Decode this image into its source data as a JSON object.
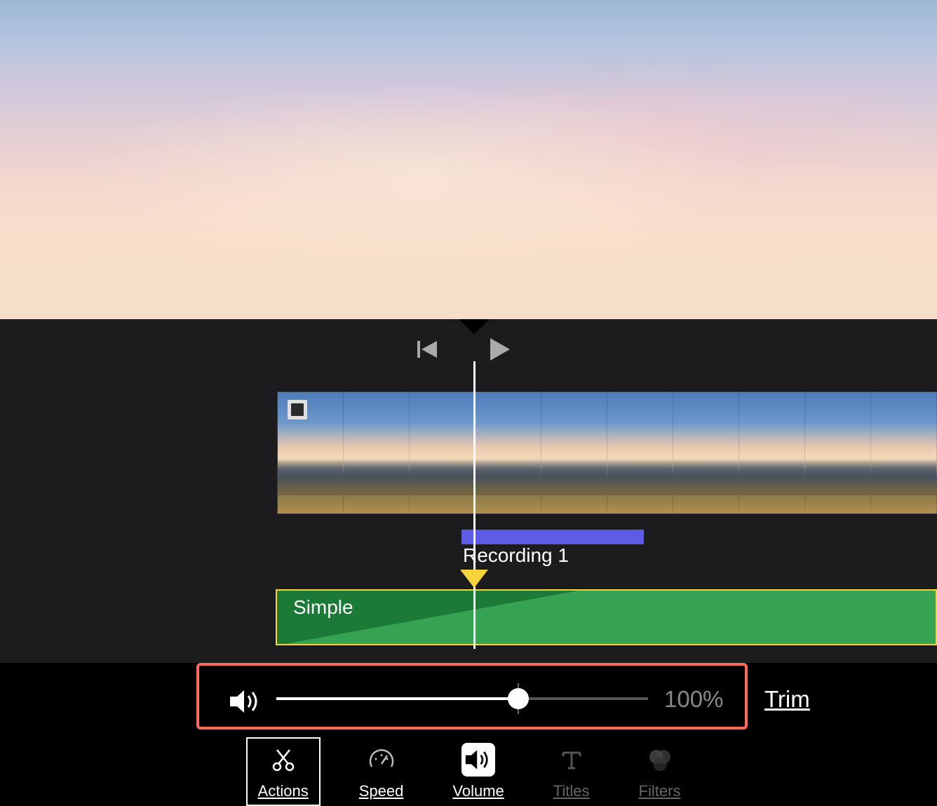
{
  "timeline": {
    "recording_label": "Recording 1",
    "audio_track_label": "Simple"
  },
  "volume_panel": {
    "value_text": "100%",
    "slider_percent": 65,
    "trim_label": "Trim"
  },
  "toolbar": {
    "actions": "Actions",
    "speed": "Speed",
    "volume": "Volume",
    "titles": "Titles",
    "filters": "Filters"
  }
}
